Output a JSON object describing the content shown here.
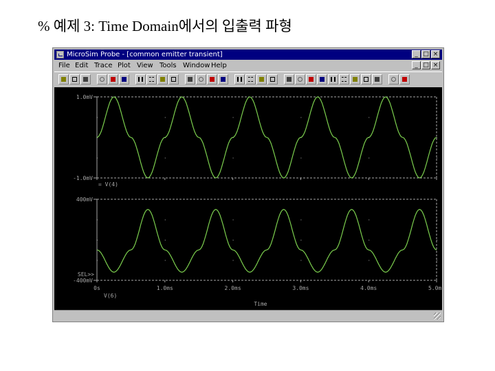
{
  "slide": {
    "title": "% 예제 3: Time Domain에서의 입출력 파형"
  },
  "window": {
    "title": "MicroSim Probe - [common emitter transient]",
    "min_glyph": "_",
    "max_glyph": "□",
    "close_glyph": "×",
    "menu": [
      "File",
      "Edit",
      "Trace",
      "Plot",
      "View",
      "Tools",
      "Window",
      "Help"
    ],
    "status": ""
  },
  "toolbar": {
    "icons": [
      "open-icon",
      "save-icon",
      "print-icon",
      "cut-icon",
      "copy-icon",
      "paste-icon",
      "zoom-in-icon",
      "zoom-out-icon",
      "zoom-area-icon",
      "zoom-fit-icon",
      "grid-icon",
      "log-x-icon",
      "fourier-icon",
      "performance-icon",
      "add-trace-icon",
      "add-plot-icon",
      "add-yaxis-icon",
      "label-icon",
      "cursor-toggle-icon",
      "cursor-peak-icon",
      "cursor-trough-icon",
      "cursor-slope-icon",
      "cursor-min-icon",
      "cursor-max-icon",
      "cursor-point-icon",
      "cursor-search-icon",
      "cursor-next-icon",
      "mark-label-icon",
      "mark-data-icon"
    ]
  },
  "colors": {
    "plot_bg": "#000000",
    "axis": "#a8a8a8",
    "trace": "#7ccf4e",
    "titlebar": "#000080"
  },
  "chart_data": [
    {
      "type": "line",
      "title": "",
      "xlabel": "Time",
      "ylabel": "",
      "x_tick_labels": [
        "0s",
        "1.0ms",
        "2.0ms",
        "3.0ms",
        "4.0ms",
        "5.0ms"
      ],
      "y_tick_labels": [
        "1.0mV",
        "-1.0mV"
      ],
      "xlim": [
        0,
        5.0
      ],
      "ylim": [
        -1.0,
        1.0
      ],
      "grid": false,
      "series": [
        {
          "name": "V(4)",
          "x": [
            0,
            0.25,
            0.5,
            0.75,
            1.0,
            1.25,
            1.5,
            1.75,
            2.0,
            2.25,
            2.5,
            2.75,
            3.0,
            3.25,
            3.5,
            3.75,
            4.0,
            4.25,
            4.5,
            4.75,
            5.0
          ],
          "values": [
            0.0,
            1.0,
            0.0,
            -1.0,
            0.0,
            1.0,
            0.0,
            -1.0,
            0.0,
            1.0,
            0.0,
            -1.0,
            0.0,
            1.0,
            0.0,
            -1.0,
            0.0,
            1.0,
            0.0,
            -1.0,
            0.0
          ]
        }
      ]
    },
    {
      "type": "line",
      "title": "",
      "xlabel": "Time",
      "ylabel": "",
      "x_tick_labels": [
        "0s",
        "1.0ms",
        "2.0ms",
        "3.0ms",
        "4.0ms",
        "5.0ms"
      ],
      "y_tick_labels": [
        "400mV",
        "-400mV"
      ],
      "xlim": [
        0,
        5.0
      ],
      "ylim": [
        -400,
        400
      ],
      "grid": false,
      "series": [
        {
          "name": "V(6)",
          "x": [
            0,
            0.25,
            0.5,
            0.75,
            1.0,
            1.25,
            1.5,
            1.75,
            2.0,
            2.25,
            2.5,
            2.75,
            3.0,
            3.25,
            3.5,
            3.75,
            4.0,
            4.25,
            4.5,
            4.75,
            5.0
          ],
          "values": [
            -100,
            -320,
            -100,
            300,
            -100,
            -320,
            -100,
            300,
            -100,
            -320,
            -100,
            300,
            -100,
            -320,
            -100,
            300,
            -100,
            -320,
            -100,
            300,
            -100
          ]
        }
      ]
    }
  ],
  "plot_labels": {
    "legend_top": "= V(4)",
    "legend_bottom": "V(6)",
    "sel_marker": "SEL>>",
    "x_axis_title": "Time"
  }
}
